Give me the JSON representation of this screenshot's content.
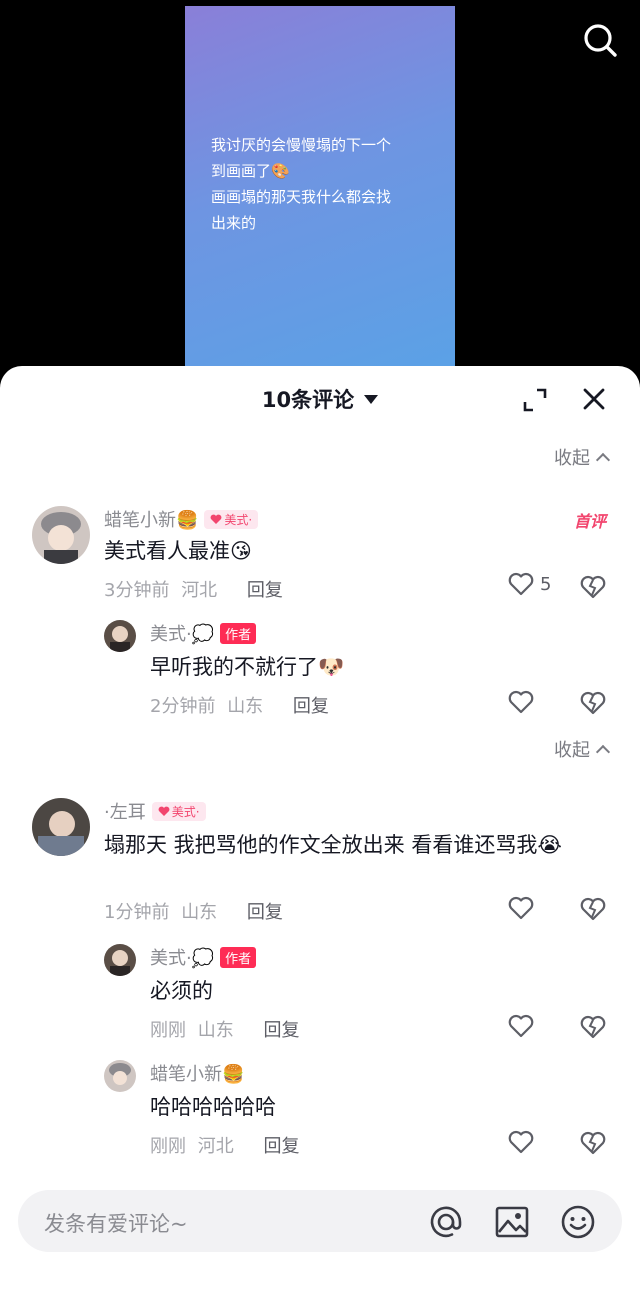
{
  "video": {
    "caption_lines": [
      "我讨厌的会慢慢塌的下一个",
      "到画画了🎨",
      "画画塌的那天我什么都会找",
      "出来的"
    ]
  },
  "sheet": {
    "title": "10条评论",
    "collapse_label": "收起"
  },
  "comments": [
    {
      "name": "蜡笔小新🍔",
      "badge": "美式·",
      "text": "美式看人最准😘",
      "time": "3分钟前",
      "location": "河北",
      "reply_label": "回复",
      "likes": "5",
      "tag": "首评",
      "replies": [
        {
          "name": "美式·💭",
          "author_tag": "作者",
          "text": "早听我的不就行了🐶",
          "time": "2分钟前",
          "location": "山东",
          "reply_label": "回复"
        }
      ]
    },
    {
      "name": "·左耳",
      "badge": "美式·",
      "text": "塌那天 我把骂他的作文全放出来 看看谁还骂我😭",
      "time": "1分钟前",
      "location": "山东",
      "reply_label": "回复",
      "replies": [
        {
          "name": "美式·💭",
          "author_tag": "作者",
          "text": "必须的",
          "time": "刚刚",
          "location": "山东",
          "reply_label": "回复"
        },
        {
          "name": "蜡笔小新🍔",
          "text": "哈哈哈哈哈哈",
          "time": "刚刚",
          "location": "河北",
          "reply_label": "回复"
        }
      ]
    }
  ],
  "input": {
    "placeholder": "发条有爱评论~"
  },
  "colors": {
    "accent": "#fe2c55",
    "badge_bg": "#fde7ef",
    "muted": "#a4a5ab"
  }
}
